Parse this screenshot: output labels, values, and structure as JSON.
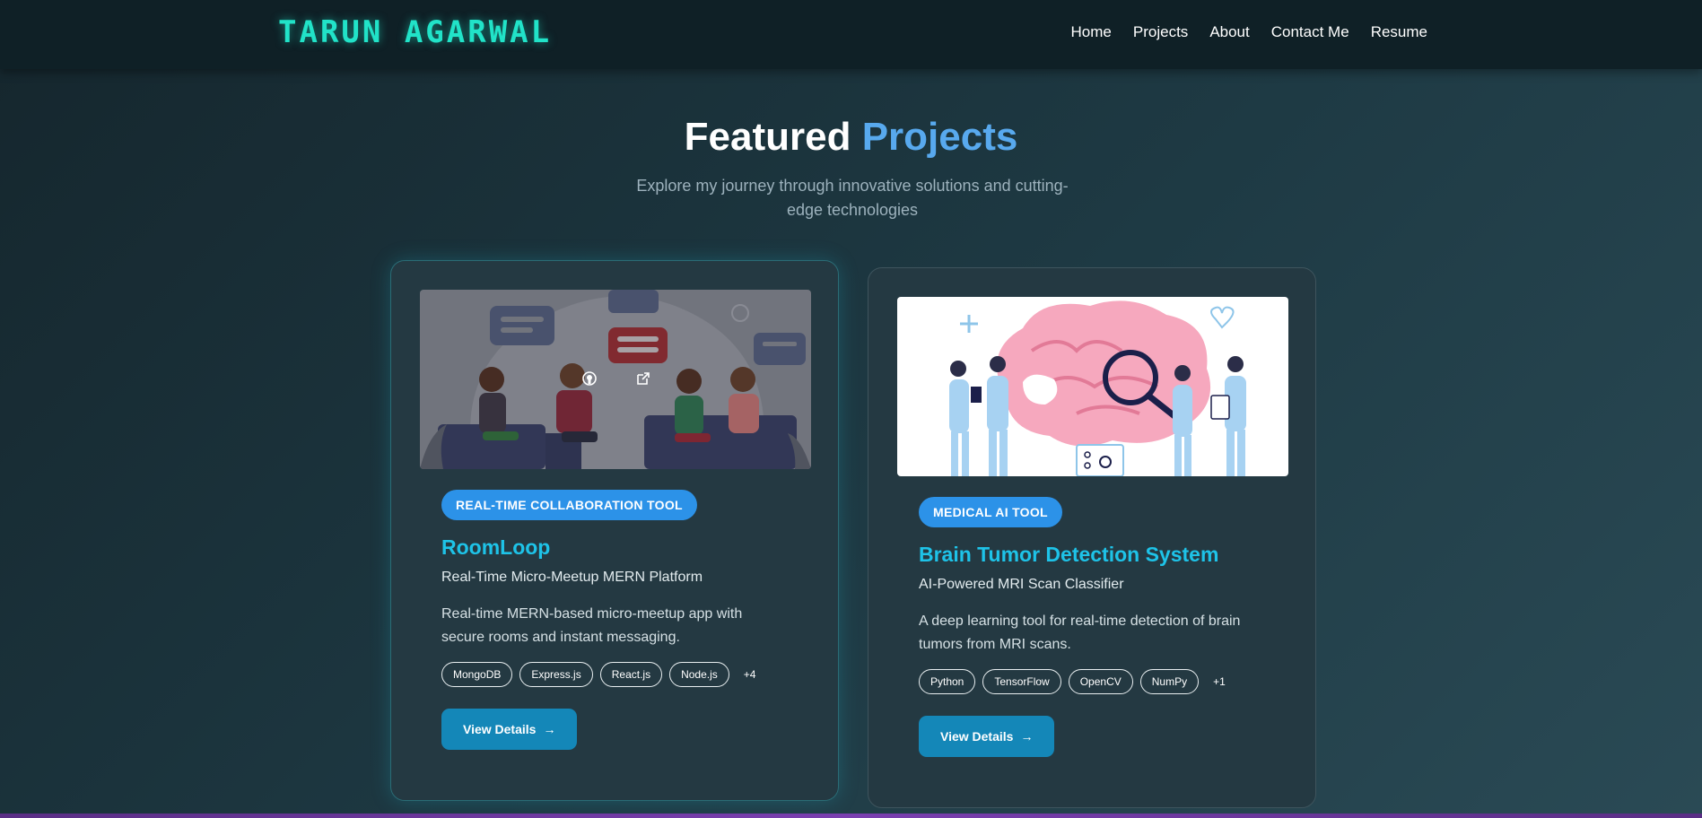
{
  "header": {
    "logo": "TARUN AGARWAL",
    "nav": [
      "Home",
      "Projects",
      "About",
      "Contact Me",
      "Resume"
    ]
  },
  "section": {
    "title_main": "Featured",
    "title_accent": "Projects",
    "subtitle": "Explore my journey through innovative solutions and cutting-edge technologies"
  },
  "projects": [
    {
      "tag": "REAL-TIME COLLABORATION TOOL",
      "title": "RoomLoop",
      "subtitle": "Real-Time Micro-Meetup MERN Platform",
      "description": "Real-time MERN-based micro-meetup app with secure rooms and instant messaging.",
      "techs": [
        "MongoDB",
        "Express.js",
        "React.js",
        "Node.js"
      ],
      "more": "+4",
      "button": "View Details",
      "image_icon": "people-chatting-illustration"
    },
    {
      "tag": "MEDICAL AI TOOL",
      "title": "Brain Tumor Detection System",
      "subtitle": "AI-Powered MRI Scan Classifier",
      "description": "A deep learning tool for real-time detection of brain tumors from MRI scans.",
      "techs": [
        "Python",
        "TensorFlow",
        "OpenCV",
        "NumPy"
      ],
      "more": "+1",
      "button": "View Details",
      "image_icon": "brain-doctors-illustration"
    }
  ],
  "colors": {
    "logo": "#21e3c8",
    "accent": "#58a9ee",
    "title": "#1ec3e8",
    "tag": "#2c92e8",
    "button": "#1487b8"
  }
}
